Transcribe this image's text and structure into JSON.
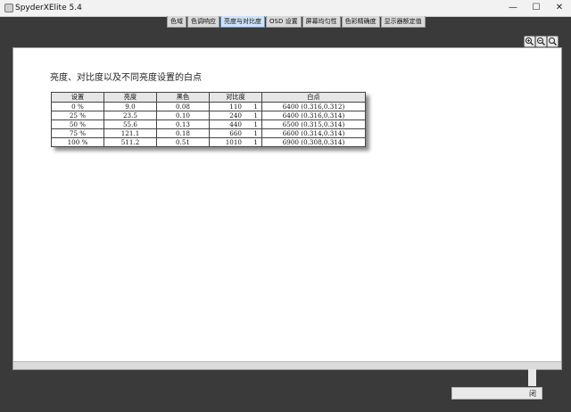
{
  "window": {
    "title": "SpyderXElite 5.4",
    "minimize": "—",
    "maximize": "☐",
    "close": "✕"
  },
  "tabs": [
    {
      "label": "色域"
    },
    {
      "label": "色调响应"
    },
    {
      "label": "亮度与对比度",
      "active": true
    },
    {
      "label": "OSD 设置"
    },
    {
      "label": "屏幕均匀性"
    },
    {
      "label": "色彩精确度"
    },
    {
      "label": "显示器额定值"
    }
  ],
  "main": {
    "heading": "亮度、对比度以及不同亮度设置的白点",
    "table": {
      "headers": [
        "设置",
        "亮度",
        "黑色",
        "对比度",
        "白点"
      ],
      "rows": [
        {
          "setting": "0 %",
          "brightness": "9.0",
          "black": "0.08",
          "contrast_a": "110",
          "contrast_b": "1",
          "white_point": "6400 (0.316,0.312)"
        },
        {
          "setting": "25 %",
          "brightness": "23.5",
          "black": "0.10",
          "contrast_a": "240",
          "contrast_b": "1",
          "white_point": "6400 (0.316,0.314)"
        },
        {
          "setting": "50 %",
          "brightness": "55.6",
          "black": "0.13",
          "contrast_a": "440",
          "contrast_b": "1",
          "white_point": "6500 (0.315,0.314)"
        },
        {
          "setting": "75 %",
          "brightness": "121.1",
          "black": "0.18",
          "contrast_a": "660",
          "contrast_b": "1",
          "white_point": "6600 (0.314,0.314)"
        },
        {
          "setting": "100 %",
          "brightness": "511.2",
          "black": "0.51",
          "contrast_a": "1010",
          "contrast_b": "1",
          "white_point": "6900 (0.308,0.314)"
        }
      ]
    }
  },
  "footer": {
    "close_label": "闭"
  },
  "colors": {
    "background": "#3a3a3a",
    "active_tab": "#cfe2f7"
  },
  "icons": [
    "zoom-in-icon",
    "zoom-out-icon",
    "zoom-fit-icon"
  ]
}
